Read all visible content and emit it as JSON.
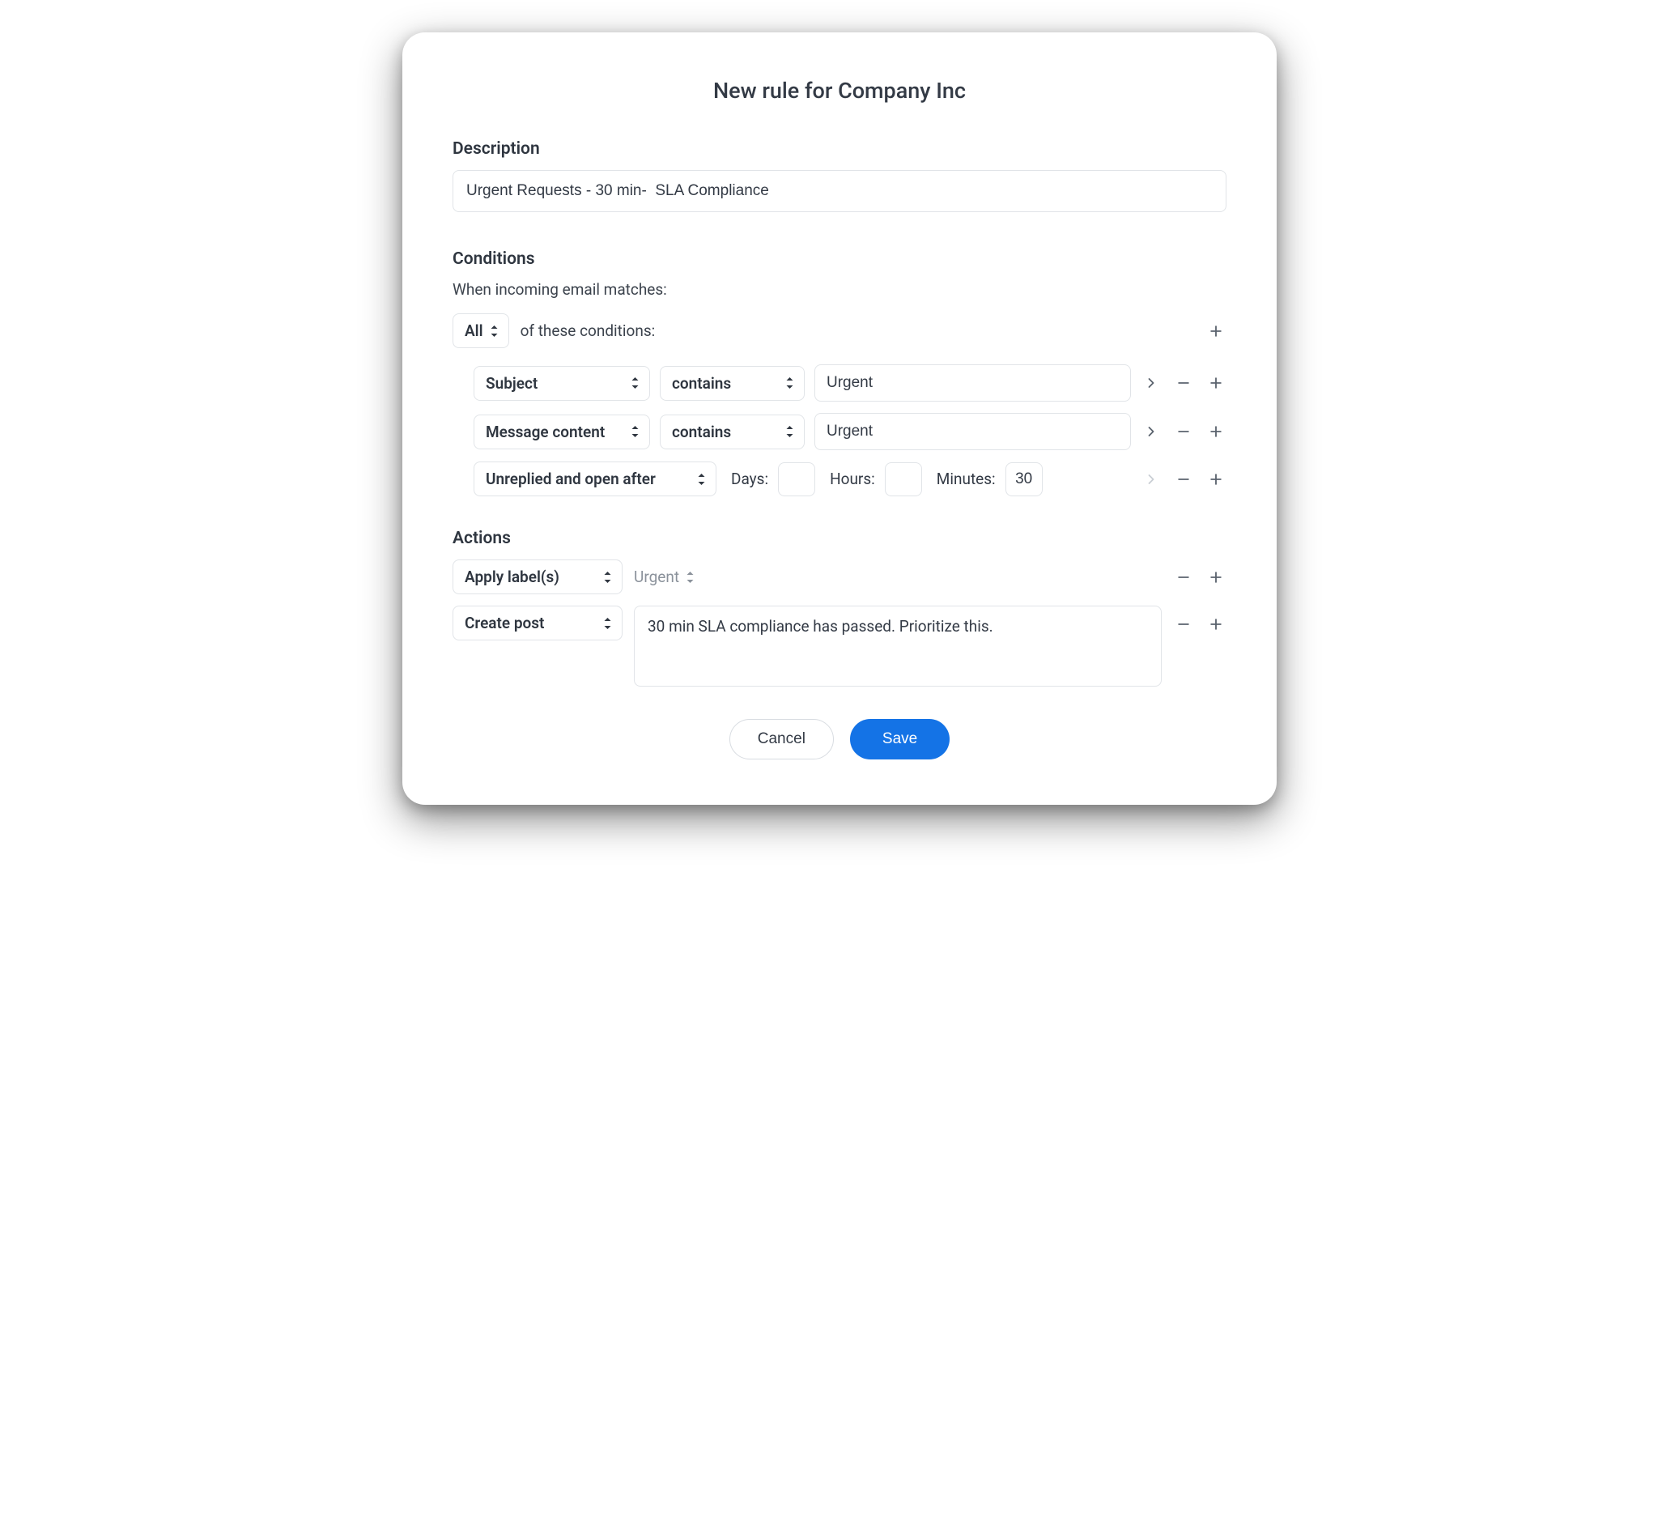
{
  "title": "New rule for Company Inc",
  "description": {
    "label": "Description",
    "value": "Urgent Requests - 30 min-  SLA Compliance"
  },
  "conditions": {
    "label": "Conditions",
    "intro": "When incoming email matches:",
    "match_mode": "All",
    "match_suffix": "of these conditions:",
    "rows": [
      {
        "field": "Subject",
        "operator": "contains",
        "value": "Urgent"
      },
      {
        "field": "Message content",
        "operator": "contains",
        "value": "Urgent"
      }
    ],
    "time_row": {
      "field": "Unreplied and open after",
      "days_label": "Days:",
      "days_value": "",
      "hours_label": "Hours:",
      "hours_value": "",
      "minutes_label": "Minutes:",
      "minutes_value": "30"
    }
  },
  "actions": {
    "label": "Actions",
    "rows": [
      {
        "action": "Apply label(s)",
        "label_value": "Urgent"
      },
      {
        "action": "Create post",
        "post_value": "30 min SLA compliance has passed. Prioritize this."
      }
    ]
  },
  "footer": {
    "cancel": "Cancel",
    "save": "Save"
  }
}
